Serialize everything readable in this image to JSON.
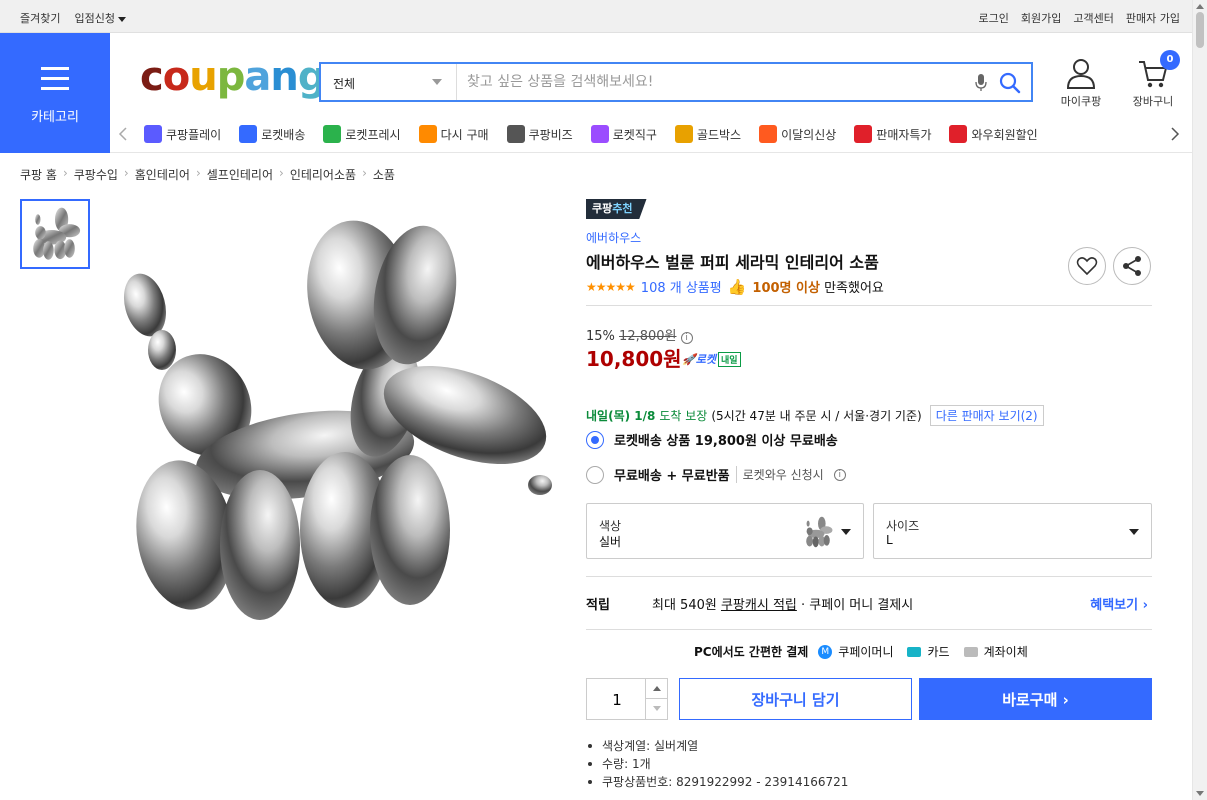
{
  "topbar": {
    "left": [
      "즐겨찾기",
      "입점신청"
    ],
    "right": [
      "로그인",
      "회원가입",
      "고객센터",
      "판매자 가입"
    ]
  },
  "header": {
    "category_label": "카테고리",
    "logo": "coupang",
    "search": {
      "scope": "전체",
      "placeholder": "찾고 싶은 상품을 검색해보세요!"
    },
    "mycoupang": "마이쿠팡",
    "cart": "장바구니",
    "cart_count": "0"
  },
  "shortcuts": [
    {
      "label": "쿠팡플레이",
      "icon": "play-icon",
      "color": "#5b5bff"
    },
    {
      "label": "로켓배송",
      "icon": "rocket-icon",
      "color": "#346aff"
    },
    {
      "label": "로켓프레시",
      "icon": "rocket-fresh-icon",
      "color": "#2bb24c"
    },
    {
      "label": "다시 구매",
      "icon": "rebuy-icon",
      "color": "#ff8a00"
    },
    {
      "label": "쿠팡비즈",
      "icon": "biz-icon",
      "color": "#555555"
    },
    {
      "label": "로켓직구",
      "icon": "rocket-global-icon",
      "color": "#9b4dff"
    },
    {
      "label": "골드박스",
      "icon": "goldbox-icon",
      "color": "#e8a100"
    },
    {
      "label": "이달의신상",
      "icon": "new-icon",
      "color": "#ff5a1f"
    },
    {
      "label": "판매자특가",
      "icon": "seller-deal-icon",
      "color": "#e0202a"
    },
    {
      "label": "와우회원할인",
      "icon": "wow-icon",
      "color": "#e0202a"
    }
  ],
  "breadcrumb": [
    "쿠팡 홈",
    "쿠팡수입",
    "홈인테리어",
    "셀프인테리어",
    "인테리어소품",
    "소품"
  ],
  "product": {
    "badge_a": "쿠팡",
    "badge_b": "추천",
    "brand": "에버하우스",
    "title": "에버하우스 벌룬 퍼피 세라믹 인테리어 소품",
    "stars": "★★★★★",
    "review_count": "108 개 상품평",
    "satisfied_a": "100명 이상",
    "satisfied_b": "만족했어요",
    "discount_rate": "15%",
    "original_price": "12,800원",
    "price": "10,800원",
    "rocket_label": "로켓",
    "rocket_tag": "내일",
    "delivery_date": "내일(목) 1/8",
    "delivery_guarantee": "도착 보장",
    "delivery_note": "(5시간 47분 내 주문 시 / 서울·경기 기준)",
    "other_sellers": "다른 판매자 보기(2)",
    "option1": "로켓배송 상품 19,800원 이상 무료배송",
    "option2": "무료배송 + 무료반품",
    "option2_sub": "로켓와우 신청시",
    "color_key": "색상",
    "color_val": "실버",
    "size_key": "사이즈",
    "size_val": "L",
    "reward_key": "적립",
    "reward_text_a": "최대 540원",
    "reward_text_b": "쿠팡캐시 적립",
    "reward_text_c": "· 쿠페이 머니 결제시",
    "reward_link": "혜택보기",
    "pcpay_label": "PC에서도 간편한 결제",
    "pay_money": "쿠페이머니",
    "pay_card": "카드",
    "pay_bank": "계좌이체",
    "quantity": "1",
    "cart_button": "장바구니 담기",
    "buy_button": "바로구매",
    "specs": [
      "색상계열: 실버계열",
      "수량: 1개",
      "쿠팡상품번호: 8291922992 - 23914166721"
    ]
  },
  "colors": {
    "accent": "#346aff",
    "price": "#ae0000",
    "star": "#ff9000"
  }
}
